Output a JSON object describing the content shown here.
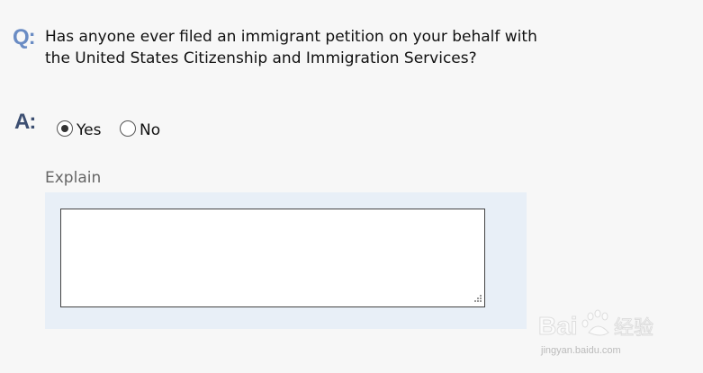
{
  "question": {
    "marker": "Q:",
    "text": "Has anyone ever filed an immigrant petition on your behalf with the United States Citizenship and Immigration Services?"
  },
  "answer": {
    "marker": "A:",
    "options": [
      {
        "label": "Yes",
        "selected": true
      },
      {
        "label": "No",
        "selected": false
      }
    ]
  },
  "explain": {
    "label": "Explain",
    "value": ""
  },
  "watermark": {
    "text": "Bai经验",
    "subtext": "jingyan.baidu.com"
  }
}
